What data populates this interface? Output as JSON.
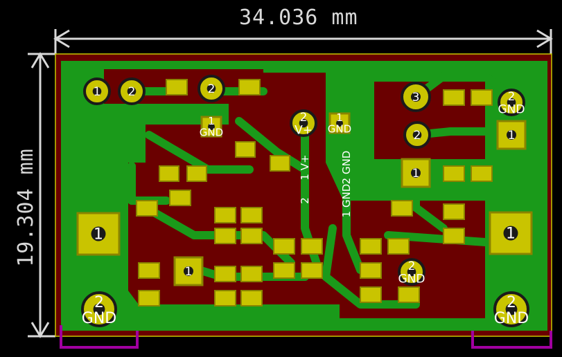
{
  "dimensions": {
    "width": "34.036 mm",
    "height": "19.304 mm"
  },
  "colors": {
    "background": "#000000",
    "substrate": "#6a0000",
    "copper_fill": "#1a9a1a",
    "trace": "#1a9a1a",
    "pad": "#c9c400",
    "pad_dark": "#8a8400",
    "silk": "#ffffff",
    "dimension": "#d8d8d8",
    "courtyard": "#a000a0",
    "edge": "#c8c800"
  },
  "pads": [
    {
      "id": "p1",
      "label": "1",
      "net": "",
      "kind": "round"
    },
    {
      "id": "p2",
      "label": "2",
      "net": "",
      "kind": "round"
    },
    {
      "id": "p3",
      "label": "2",
      "net": "",
      "kind": "round"
    },
    {
      "id": "p4",
      "label": "1",
      "net": "GND",
      "kind": "square"
    },
    {
      "id": "p5",
      "label": "2",
      "net": "V+",
      "kind": "round"
    },
    {
      "id": "p6",
      "label": "1",
      "net": "GND",
      "kind": "square"
    },
    {
      "id": "p7",
      "label": "3",
      "net": "",
      "kind": "round"
    },
    {
      "id": "p8",
      "label": "2",
      "net": "",
      "kind": "round"
    },
    {
      "id": "p9",
      "label": "1",
      "net": "",
      "kind": "square"
    },
    {
      "id": "p10",
      "label": "2",
      "net": "GND",
      "kind": "round"
    },
    {
      "id": "p11",
      "label": "1",
      "net": "",
      "kind": "square"
    },
    {
      "id": "p12",
      "label": "1",
      "net": "",
      "kind": "square"
    },
    {
      "id": "p13",
      "label": "1",
      "net": "",
      "kind": "square"
    },
    {
      "id": "p14",
      "label": "1",
      "net": "",
      "kind": "square"
    },
    {
      "id": "p15",
      "label": "2",
      "net": "GND",
      "kind": "round"
    },
    {
      "id": "p16",
      "label": "2",
      "net": "GND",
      "kind": "round"
    },
    {
      "id": "p17",
      "label": "2",
      "net": "GND",
      "kind": "round"
    }
  ],
  "connector_labels": [
    {
      "id": "c1",
      "num": "1",
      "net": "V+"
    },
    {
      "id": "c2",
      "num": "2",
      "net": "GND"
    },
    {
      "id": "c3",
      "num": "2",
      "net": ""
    },
    {
      "id": "c4",
      "num": "1",
      "net": "GND"
    }
  ]
}
